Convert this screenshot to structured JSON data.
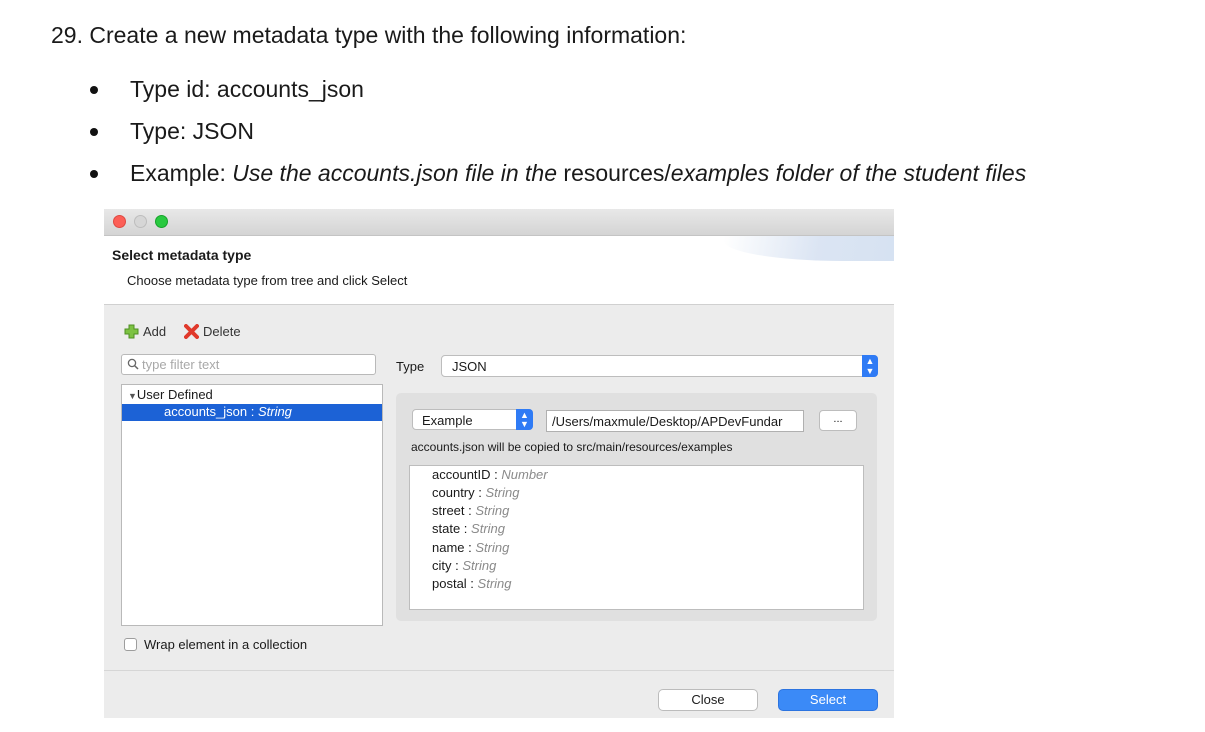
{
  "doc": {
    "heading": "29. Create a new metadata type with the following information:",
    "bullets": {
      "type_id": "Type id: accounts_json",
      "type": "Type: JSON",
      "example_label": "Example: ",
      "example_italic_1": "Use the accounts.json file in the",
      "example_plain": " resources/",
      "example_italic_2": "examples folder of the student files"
    }
  },
  "dialog": {
    "title": "Select metadata type",
    "subtitle": "Choose metadata type from tree and click Select",
    "toolbar": {
      "add": "Add",
      "delete": "Delete"
    },
    "filter_placeholder": "type filter text",
    "tree": {
      "root": "User Defined",
      "selected_name": "accounts_json : ",
      "selected_type": "String"
    },
    "type_label": "Type",
    "type_value": "JSON",
    "example_select": "Example",
    "example_path": "/Users/maxmule/Desktop/APDevFundar",
    "browse_label": "...",
    "copy_note": "accounts.json will be copied to src/main/resources/examples",
    "fields": [
      {
        "name": "accountID : ",
        "type": "Number"
      },
      {
        "name": "country : ",
        "type": "String"
      },
      {
        "name": "street : ",
        "type": "String"
      },
      {
        "name": "state : ",
        "type": "String"
      },
      {
        "name": "name : ",
        "type": "String"
      },
      {
        "name": "city : ",
        "type": "String"
      },
      {
        "name": "postal : ",
        "type": "String"
      }
    ],
    "wrap_label": "Wrap element in a collection",
    "close_button": "Close",
    "select_button": "Select",
    "colors": {
      "accent": "#2f7bf5",
      "selection": "#1c62d6",
      "close_light": "#fc5f57",
      "zoom_light": "#29c940"
    }
  }
}
